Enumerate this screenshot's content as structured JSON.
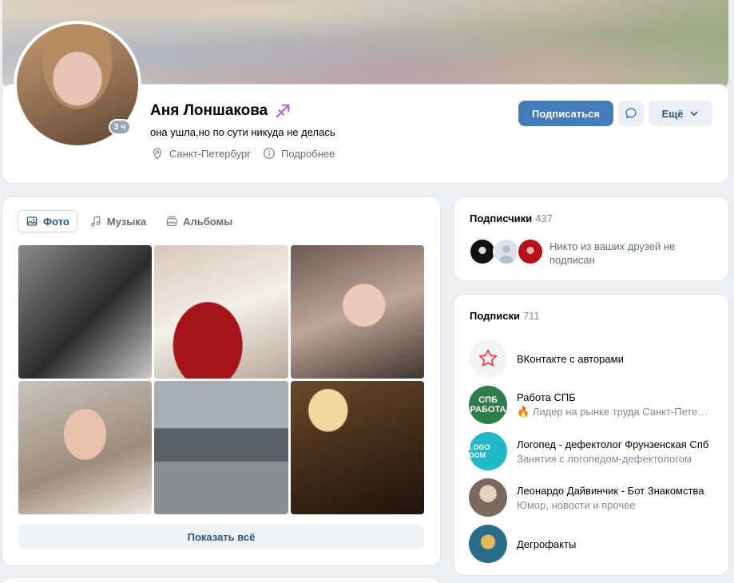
{
  "profile": {
    "name": "Аня Лоншакова",
    "online": "3 ч",
    "status": "она ушла,но по сути никуда не делась",
    "city": "Санкт-Петербург",
    "details_label": "Подробнее",
    "subscribe_label": "Подписаться",
    "more_label": "Ещё"
  },
  "tabs": [
    {
      "label": "Фото",
      "icon": "image-icon",
      "active": true
    },
    {
      "label": "Музыка",
      "icon": "music-note-icon",
      "active": false
    },
    {
      "label": "Альбомы",
      "icon": "albums-icon",
      "active": false
    }
  ],
  "photos": {
    "show_all_label": "Показать всё"
  },
  "followers": {
    "title": "Подписчики",
    "count": "437",
    "text": "Никто из ваших друзей не подписан"
  },
  "subscriptions": {
    "title": "Подписки",
    "count": "711",
    "items": [
      {
        "name": "ВКонтакте с авторами",
        "desc": ""
      },
      {
        "name": "Работа СПБ",
        "avatar_text": "СПБ\nРАБОТА",
        "desc": "🔥 Лидер на рынке труда Санкт-Петербурга"
      },
      {
        "name": "Логопед - дефектолог Фрунзенская Спб",
        "avatar_text": "LOGO DOM",
        "desc": "Занятия с логопедом-дефектологом"
      },
      {
        "name": "Леонардо Дайвинчик - Бот Знакомства",
        "desc": "Юмор, новости и прочее"
      },
      {
        "name": "Дегрофакты",
        "desc": ""
      }
    ]
  },
  "colors": {
    "accent": "#447bba",
    "link": "#2a5885",
    "secondary": "#626d7a",
    "badge": "#99a2ad"
  }
}
